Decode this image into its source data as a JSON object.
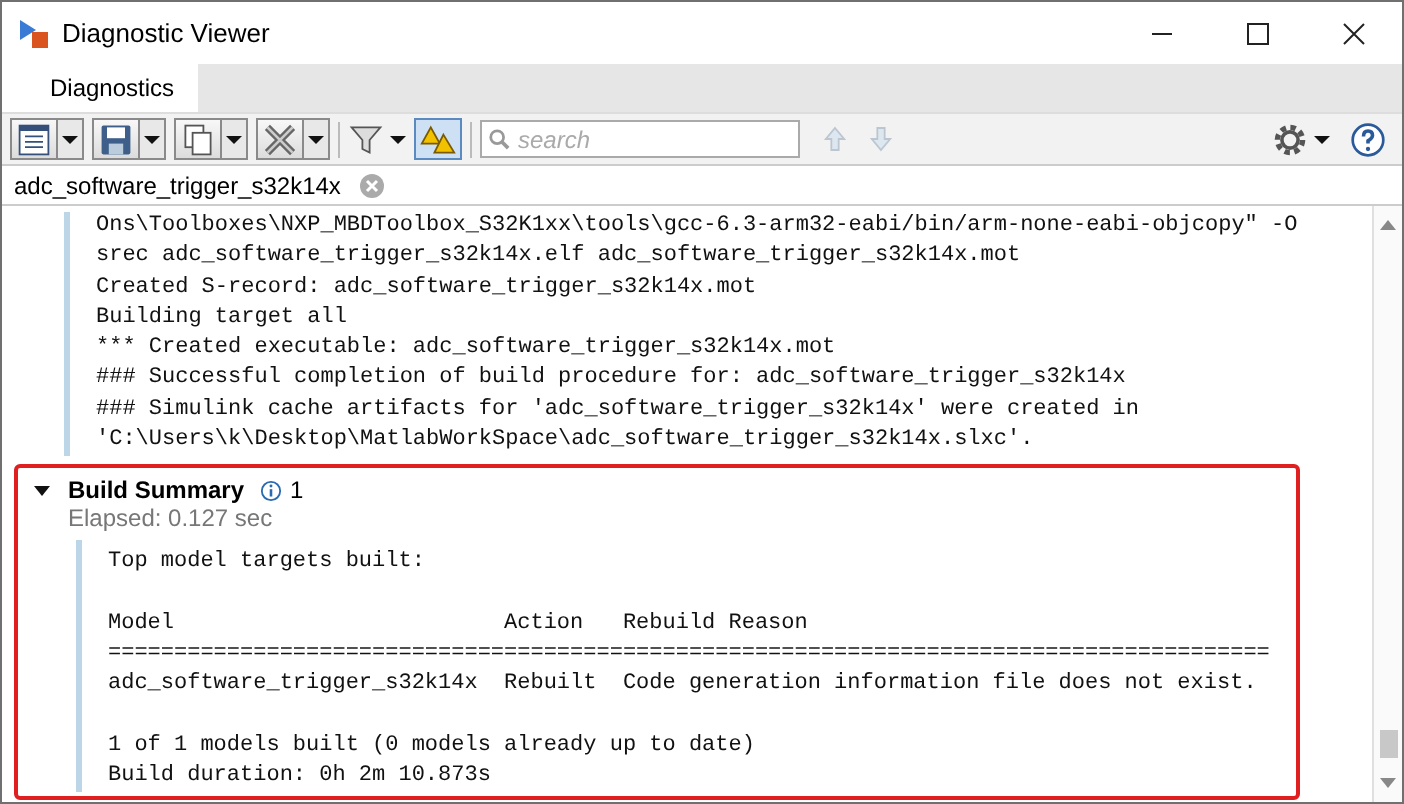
{
  "window": {
    "title": "Diagnostic Viewer"
  },
  "tabs": [
    {
      "label": "Diagnostics",
      "selected": true
    }
  ],
  "toolbar": {
    "warnings_toggle": {
      "on": true
    },
    "search": {
      "placeholder": "search"
    },
    "nav_disabled": true
  },
  "document_tab": {
    "label": "adc_software_trigger_s32k14x"
  },
  "log": [
    "Ons\\Toolboxes\\NXP_MBDToolbox_S32K1xx\\tools\\gcc-6.3-arm32-eabi/bin/arm-none-eabi-objcopy\" -O",
    "srec adc_software_trigger_s32k14x.elf adc_software_trigger_s32k14x.mot",
    "Created S-record: adc_software_trigger_s32k14x.mot",
    "Building target all",
    "*** Created executable: adc_software_trigger_s32k14x.mot",
    "### Successful completion of build procedure for: adc_software_trigger_s32k14x",
    "### Simulink cache artifacts for 'adc_software_trigger_s32k14x' were created in",
    "'C:\\Users\\k\\Desktop\\MatlabWorkSpace\\adc_software_trigger_s32k14x.slxc'."
  ],
  "summary": {
    "title": "Build Summary",
    "expanded": true,
    "info_count": "1",
    "elapsed": "Elapsed: 0.127 sec",
    "highlighted": true,
    "paragraphs": [
      [
        "Top model targets built:"
      ],
      [
        "Model                         Action   Rebuild Reason",
        "========================================================================================",
        "adc_software_trigger_s32k14x  Rebuilt  Code generation information file does not exist."
      ],
      [
        "1 of 1 models built (0 models already up to date)",
        "Build duration: 0h 2m 10.873s"
      ]
    ]
  }
}
